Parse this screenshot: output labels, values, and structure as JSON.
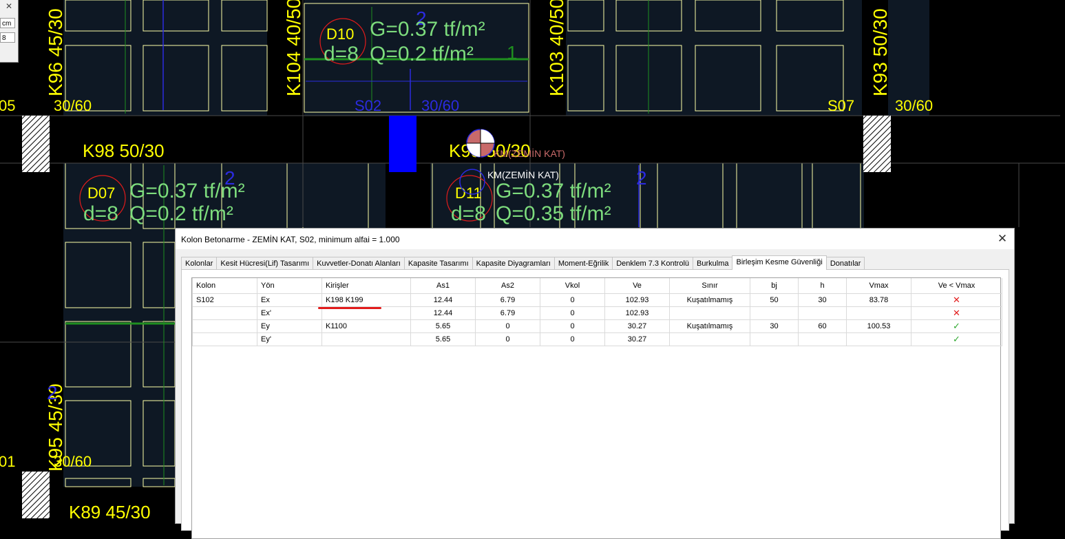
{
  "cad": {
    "mini_panel": {
      "unit": "cm",
      "value": "8"
    },
    "beam_labels": [
      "K96 45/30",
      "K104 40/50",
      "K103 40/50",
      "K93 50/30",
      "K95 45/30",
      "K98 50/30",
      "K99 50/30",
      "K89 45/30"
    ],
    "dims": [
      "30/60",
      "30/60",
      "30/60",
      "30/60"
    ],
    "column_names": [
      "S02",
      "S07"
    ],
    "edge_labels": [
      "05",
      "01"
    ],
    "slabs": [
      {
        "id": "D10",
        "load_g": "G=0.37 tf/m²",
        "thickness": "d=8",
        "load_q": "Q=0.2 tf/m²"
      },
      {
        "id": "D07",
        "load_g": "G=0.37 tf/m²",
        "thickness": "d=8",
        "load_q": "Q=0.2 tf/m²"
      },
      {
        "id": "D11",
        "load_g": "G=0.37 tf/m²",
        "thickness": "d=8",
        "load_q": "Q=0.35 tf/m²"
      }
    ],
    "span_numbers": [
      "2",
      "1",
      "2",
      "2",
      "2"
    ],
    "mass_labels": [
      "KM(ZEMİN KAT)",
      "KM(ZEMİN KAT)"
    ],
    "colors": {
      "yellow": "#ffff00",
      "green": "#7ddc7d",
      "slab_line": "#ffffa8",
      "blue": "#2b2be0",
      "red": "#e21b1b",
      "dark_green": "#1f8f1f"
    }
  },
  "dialog": {
    "title": "Kolon Betonarme - ZEMİN KAT, S02, minimum alfai = 1.000",
    "close_glyph": "✕",
    "tabs": [
      "Kolonlar",
      "Kesit Hücresi(Lif) Tasarımı",
      "Kuvvetler-Donatı Alanları",
      "Kapasite Tasarımı",
      "Kapasite Diyagramları",
      "Moment-Eğrilik",
      "Denklem 7.3 Kontrolü",
      "Burkulma",
      "Birleşim Kesme Güvenliği",
      "Donatılar"
    ],
    "active_tab": 8,
    "table": {
      "headers": [
        "Kolon",
        "Yön",
        "Kirişler",
        "As1",
        "As2",
        "Vkol",
        "Ve",
        "Sınır",
        "bj",
        "h",
        "Vmax",
        "Ve < Vmax"
      ],
      "rows": [
        {
          "kolon": "S102",
          "yon": "Ex",
          "kirisler": "K198 K199",
          "as1": "12.44",
          "as2": "6.79",
          "vkol": "0",
          "ve": "102.93",
          "sinir": "Kuşatılmamış",
          "bj": "50",
          "h": "30",
          "vmax": "83.78",
          "ok": false
        },
        {
          "kolon": "",
          "yon": "Ex'",
          "kirisler": "",
          "as1": "12.44",
          "as2": "6.79",
          "vkol": "0",
          "ve": "102.93",
          "sinir": "",
          "bj": "",
          "h": "",
          "vmax": "",
          "ok": false
        },
        {
          "kolon": "",
          "yon": "Ey",
          "kirisler": "K1100",
          "as1": "5.65",
          "as2": "0",
          "vkol": "0",
          "ve": "30.27",
          "sinir": "Kuşatılmamış",
          "bj": "30",
          "h": "60",
          "vmax": "100.53",
          "ok": true
        },
        {
          "kolon": "",
          "yon": "Ey'",
          "kirisler": "",
          "as1": "5.65",
          "as2": "0",
          "vkol": "0",
          "ve": "30.27",
          "sinir": "",
          "bj": "",
          "h": "",
          "vmax": "",
          "ok": true
        }
      ],
      "pass_glyph": "✓",
      "fail_glyph": "✕"
    }
  }
}
